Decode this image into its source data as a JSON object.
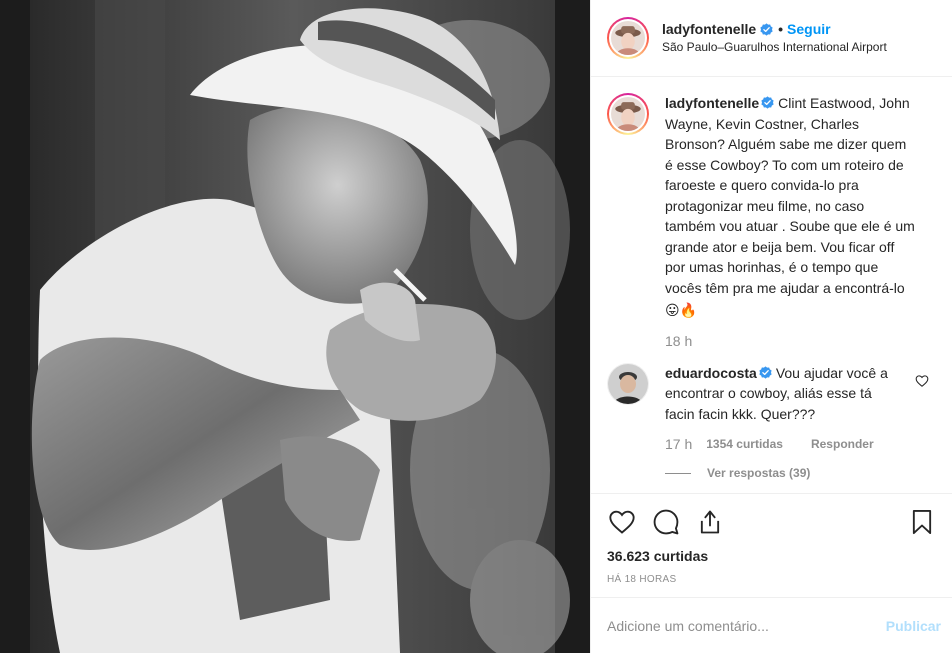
{
  "post": {
    "author": {
      "username": "ladyfontenelle",
      "verified": true,
      "follow_label": "Seguir",
      "location": "São Paulo–Guarulhos International Airport"
    },
    "media": {
      "description_icon": "photo"
    },
    "caption": {
      "username": "ladyfontenelle",
      "text": "Clint Eastwood, John Wayne, Kevin Costner, Charles Bronson? Alguém sabe me dizer quem é esse Cowboy? To com um roteiro de faroeste e quero convida-lo pra protagonizar meu filme, no caso também vou atuar . Soube que ele é um grande ator e beija bem. Vou ficar off por umas horinhas, é o tempo que vocês têm pra me ajudar a encontrá-lo",
      "emojis": "😛🔥",
      "time": "18 h"
    },
    "comments": [
      {
        "username": "eduardocosta",
        "verified": true,
        "text": "Vou ajudar você a encontrar o cowboy, aliás esse tá facin facin kkk. Quer???",
        "time": "17 h",
        "likes": "1354 curtidas",
        "reply_label": "Responder",
        "view_replies": "Ver respostas (39)"
      }
    ],
    "likes_count": "36.623 curtidas",
    "time_ago": "HÁ 18 HORAS",
    "add_comment": {
      "placeholder": "Adicione um comentário...",
      "publish_label": "Publicar"
    },
    "colors": {
      "accent": "#0095f6",
      "publish_disabled": "#b2dffc",
      "muted": "#8e8e8e",
      "text": "#262626",
      "border": "#efefef"
    }
  }
}
